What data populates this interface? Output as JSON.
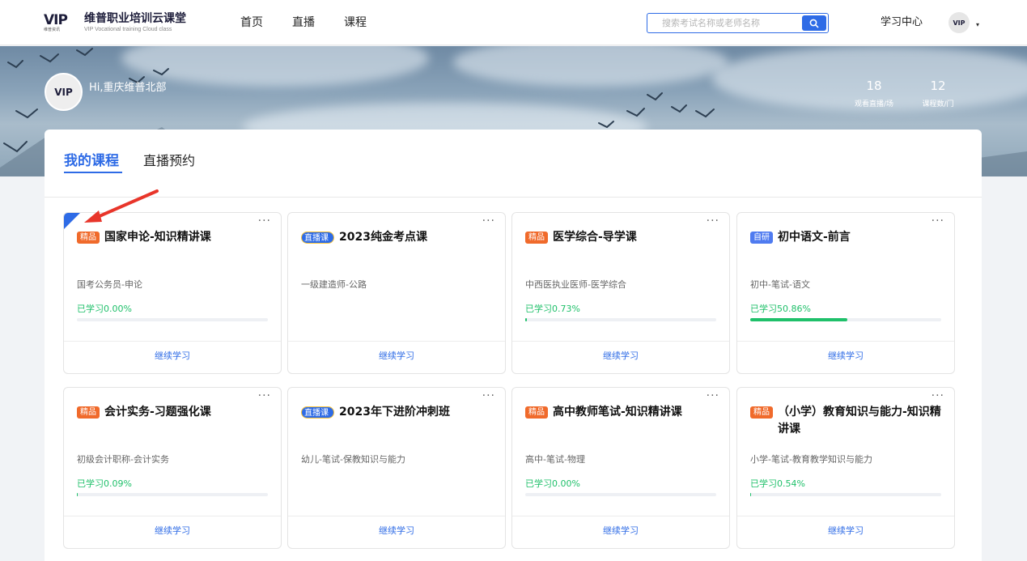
{
  "header": {
    "logo_mark": "VIP",
    "logo_sub": "维普资讯",
    "brand_title": "维普职业培训云课堂",
    "brand_subtitle": "VIP Vocational training Cloud class",
    "nav": [
      "首页",
      "直播",
      "课程"
    ],
    "search_placeholder": "搜索考试名称或老师名称",
    "study_center": "学习中心",
    "avatar_mark": "VIP"
  },
  "banner": {
    "greeting": "Hi,重庆维普北部",
    "avatar_mark": "VIP",
    "stats": [
      {
        "value": "18",
        "label": "观看直播/场"
      },
      {
        "value": "12",
        "label": "课程数/门"
      }
    ]
  },
  "tabs": [
    "我的课程",
    "直播预约"
  ],
  "colors": {
    "accent": "#2e6be6",
    "success": "#1fc06a",
    "badge_jp": "#f06a2b",
    "badge_zy": "#4f7bf0",
    "annotation": "#e8352a"
  },
  "cards": [
    {
      "badge": "精品",
      "badge_type": "jp",
      "title": "国家申论-知识精讲课",
      "category": "国考公务员-申论",
      "progress_label": "已学习0.00%",
      "progress": 0.0,
      "action": "继续学习",
      "more": "···",
      "highlight": true
    },
    {
      "badge": "直播课",
      "badge_type": "zb",
      "title": "2023纯金考点课",
      "category": "一级建造师-公路",
      "progress_label": "",
      "progress": null,
      "action": "继续学习",
      "more": "···"
    },
    {
      "badge": "精品",
      "badge_type": "jp",
      "title": "医学综合-导学课",
      "category": "中西医执业医师-医学综合",
      "progress_label": "已学习0.73%",
      "progress": 0.0073,
      "action": "继续学习",
      "more": "···"
    },
    {
      "badge": "自研",
      "badge_type": "zy",
      "title": "初中语文-前言",
      "category": "初中-笔试-语文",
      "progress_label": "已学习50.86%",
      "progress": 0.5086,
      "action": "继续学习",
      "more": "···"
    },
    {
      "badge": "精品",
      "badge_type": "jp",
      "title": "会计实务-习题强化课",
      "category": "初级会计职称-会计实务",
      "progress_label": "已学习0.09%",
      "progress": 0.0009,
      "action": "继续学习",
      "more": "···"
    },
    {
      "badge": "直播课",
      "badge_type": "zb",
      "title": "2023年下进阶冲刺班",
      "category": "幼儿-笔试-保教知识与能力",
      "progress_label": "",
      "progress": null,
      "action": "继续学习",
      "more": "···"
    },
    {
      "badge": "精品",
      "badge_type": "jp",
      "title": "高中教师笔试-知识精讲课",
      "category": "高中-笔试-物理",
      "progress_label": "已学习0.00%",
      "progress": 0.0,
      "action": "继续学习",
      "more": "···"
    },
    {
      "badge": "精品",
      "badge_type": "jp",
      "title": "（小学）教育知识与能力-知识精讲课",
      "category": "小学-笔试-教育教学知识与能力",
      "progress_label": "已学习0.54%",
      "progress": 0.0054,
      "action": "继续学习",
      "more": "···"
    }
  ]
}
